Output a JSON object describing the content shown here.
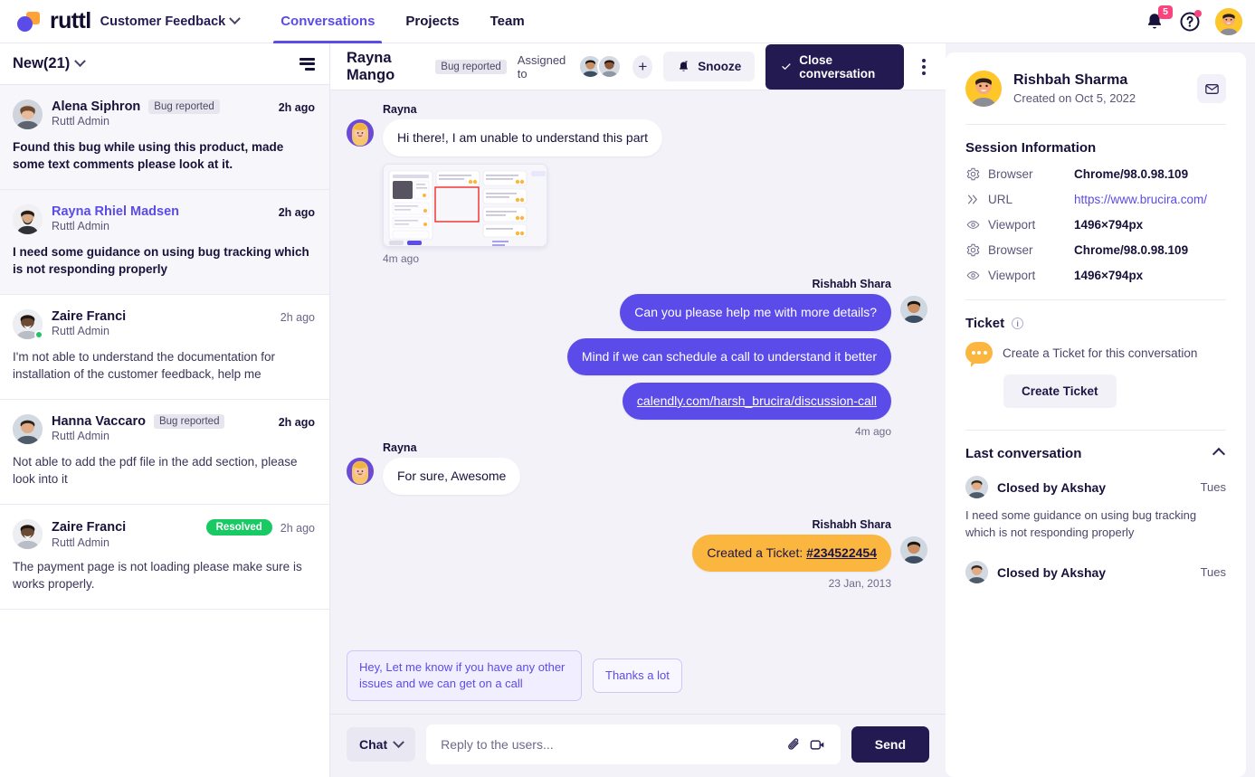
{
  "topbar": {
    "logo_text": "ruttl",
    "workspace": "Customer Feedback",
    "nav": [
      {
        "label": "Conversations",
        "active": true
      },
      {
        "label": "Projects",
        "active": false
      },
      {
        "label": "Team",
        "active": false
      }
    ],
    "notification_count": "5",
    "help_label": "?"
  },
  "list": {
    "title": "New(21)",
    "conversations": [
      {
        "name": "Alena Siphron",
        "tag": "Bug reported",
        "tag_type": "bug",
        "role": "Ruttl Admin",
        "time": "2h ago",
        "text": "Found this bug while using this product, made some text comments please look at it.",
        "unread": true,
        "shaded": true,
        "online": false,
        "name_link": false
      },
      {
        "name": "Rayna Rhiel Madsen",
        "tag": "",
        "tag_type": "",
        "role": "Ruttl Admin",
        "time": "2h ago",
        "text": "I need some guidance on using bug tracking which is not responding properly",
        "unread": true,
        "shaded": true,
        "online": false,
        "name_link": true
      },
      {
        "name": "Zaire Franci",
        "tag": "",
        "tag_type": "",
        "role": "Ruttl Admin",
        "time": "2h ago",
        "text": "I'm not able to understand the documentation for installation of the customer feedback, help me",
        "unread": false,
        "shaded": false,
        "online": true,
        "name_link": false
      },
      {
        "name": "Hanna Vaccaro",
        "tag": "Bug reported",
        "tag_type": "bug",
        "role": "Ruttl Admin",
        "time": "2h ago",
        "text": "Not able to add the pdf file in the add section, please look into it",
        "unread": true,
        "shaded": false,
        "online": false,
        "name_link": false
      },
      {
        "name": "Zaire Franci",
        "tag": "Resolved",
        "tag_type": "resolved",
        "role": "Ruttl Admin",
        "time": "2h ago",
        "text": "The payment page is not loading please make sure is works properly.",
        "unread": false,
        "shaded": false,
        "online": false,
        "name_link": false
      }
    ]
  },
  "chat": {
    "title": "Rayna Mango",
    "tag": "Bug reported",
    "assigned_label": "Assigned to",
    "add_assignee": "+",
    "snooze_label": "Snooze",
    "close_label": "Close conversation",
    "messages": [
      {
        "side": "in",
        "sender": "Rayna",
        "text": "Hi there!, I am unable to understand this part",
        "has_attachment": true,
        "time": "4m ago"
      },
      {
        "side": "out",
        "sender": "Rishabh Shara",
        "lines": [
          "Can you please help me with more details?",
          "Mind if we can schedule a call to understand it better",
          "calendly.com/harsh_brucira/discussion-call"
        ],
        "link_index": 2,
        "time": "4m ago"
      },
      {
        "side": "in",
        "sender": "Rayna",
        "text": "For sure, Awesome",
        "has_attachment": false,
        "time": ""
      },
      {
        "side": "out",
        "sender": "Rishabh Shara",
        "ticket_prefix": "Created a Ticket: ",
        "ticket_id": "#234522454",
        "time": "23 Jan, 2013"
      }
    ],
    "suggestions": [
      "Hey, Let me know if you have any other issues and we can get on a call",
      "Thanks a lot"
    ],
    "composer": {
      "mode": "Chat",
      "placeholder": "Reply to the users...",
      "value": "",
      "send_label": "Send"
    }
  },
  "details": {
    "profile": {
      "name": "Rishbah Sharma",
      "created": "Created on Oct 5, 2022"
    },
    "session_title": "Session Information",
    "session_rows": [
      {
        "icon": "gear-icon",
        "key": "Browser",
        "value": "Chrome/98.0.98.109",
        "is_link": false
      },
      {
        "icon": "url-icon",
        "key": "URL",
        "value": "https://www.brucira.com/",
        "is_link": true
      },
      {
        "icon": "eye-icon",
        "key": "Viewport",
        "value": "1496×794px",
        "is_link": false
      },
      {
        "icon": "gear-icon",
        "key": "Browser",
        "value": "Chrome/98.0.98.109",
        "is_link": false
      },
      {
        "icon": "eye-icon",
        "key": "Viewport",
        "value": "1496×794px",
        "is_link": false
      }
    ],
    "ticket_title": "Ticket",
    "ticket_text": "Create a Ticket for this conversation",
    "ticket_button": "Create Ticket",
    "last_conv_title": "Last conversation",
    "last_conversations": [
      {
        "name": "Closed by Akshay",
        "time": "Tues",
        "text": "I need some guidance on using bug tracking which is not responding properly"
      },
      {
        "name": "Closed by Akshay",
        "time": "Tues",
        "text": ""
      }
    ]
  },
  "colors": {
    "accent": "#5b4be8",
    "dark": "#241a52",
    "ticket_yellow": "#fbb63f",
    "resolved_green": "#18c964",
    "badge_pink": "#f9447f",
    "chat_bg": "#f2f2f8"
  }
}
